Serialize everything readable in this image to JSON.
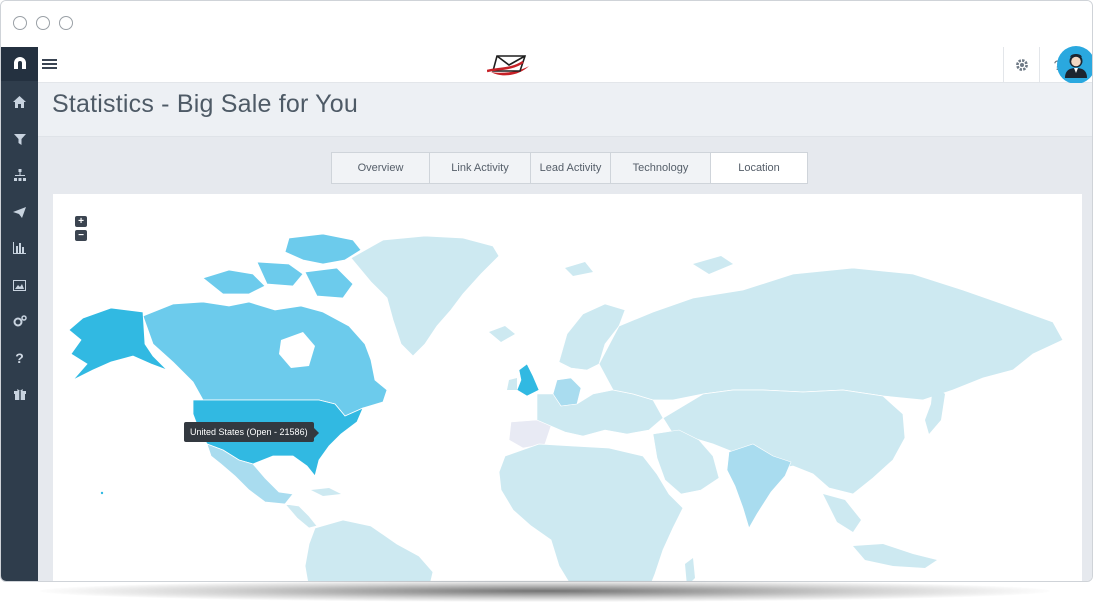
{
  "page": {
    "title": "Statistics - Big Sale for You"
  },
  "topbar": {
    "settings_icon": "gear-icon",
    "help_label": "?",
    "avatar_icon": "user-avatar-icon"
  },
  "sidebar": {
    "items": [
      {
        "name": "home-icon",
        "glyph": "⌂"
      },
      {
        "name": "funnel-icon",
        "glyph": "⚲"
      },
      {
        "name": "hierarchy-icon",
        "glyph": "⚶"
      },
      {
        "name": "send-icon",
        "glyph": "✈"
      },
      {
        "name": "bar-chart-icon",
        "glyph": "▥"
      },
      {
        "name": "image-icon",
        "glyph": "▣"
      },
      {
        "name": "gears-icon",
        "glyph": "⚙"
      },
      {
        "name": "question-icon",
        "glyph": "?"
      },
      {
        "name": "gift-icon",
        "glyph": "⌸"
      }
    ]
  },
  "tabs": [
    {
      "label": "Overview",
      "active": false
    },
    {
      "label": "Link Activity",
      "active": false
    },
    {
      "label": "Lead Activity",
      "active": false
    },
    {
      "label": "Technology",
      "active": false
    },
    {
      "label": "Location",
      "active": true
    }
  ],
  "map": {
    "zoom_in": "+",
    "zoom_out": "−",
    "tooltip": "United States (Open - 21586)",
    "colors": {
      "high": "#31b9e2",
      "mid": "#6ccbec",
      "low": "#a9dcef",
      "base": "#cde9f1",
      "none": "#e8eaf4"
    }
  }
}
